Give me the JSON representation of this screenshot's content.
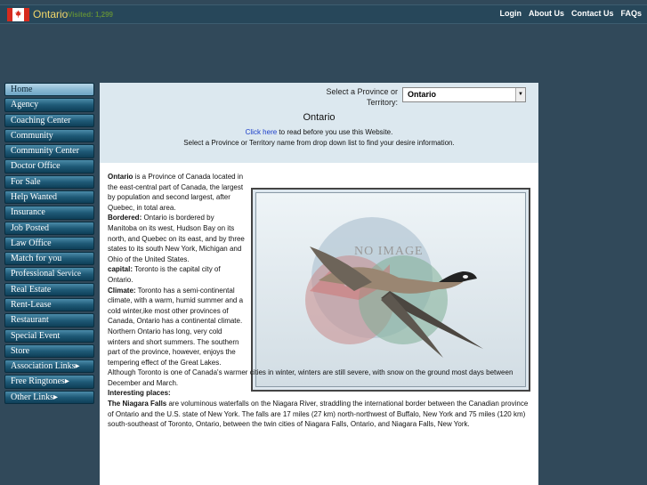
{
  "header": {
    "site_name": "Ontario",
    "visited": "Visited: 1,299",
    "nav": [
      "Login",
      "About Us",
      "Contact Us",
      "FAQs"
    ]
  },
  "sidebar": {
    "items": [
      {
        "label": "Home",
        "active": true
      },
      {
        "label": "Agency"
      },
      {
        "label": "Coaching Center"
      },
      {
        "label": "Community"
      },
      {
        "label": "Community Center"
      },
      {
        "label": "Doctor Office"
      },
      {
        "label": "For Sale"
      },
      {
        "label": "Help Wanted"
      },
      {
        "label": "Insurance"
      },
      {
        "label": "Job Posted"
      },
      {
        "label": "Law Office"
      },
      {
        "label": "Match for you"
      },
      {
        "label": "Professional",
        "small": "Service"
      },
      {
        "label": "Real Estate"
      },
      {
        "label": "Rent-Lease"
      },
      {
        "label": "Restaurant"
      },
      {
        "label": "Special Event"
      },
      {
        "label": "Store"
      },
      {
        "label": "Association Links▸"
      },
      {
        "label": "Free Ringtones▸"
      },
      {
        "label": "Other Links▸"
      }
    ]
  },
  "selector": {
    "label": "Select a Province or Territory:",
    "value": "Ontario",
    "arrow": "▼"
  },
  "main": {
    "title": "Ontario",
    "click_here": "Click here",
    "notice1_rest": " to read before you use this Website.",
    "notice2": "Select a Province or Territory name from drop down list to find your desire information.",
    "image_placeholder": "NO IMAGE"
  },
  "article": {
    "intro_bold": "Ontario",
    "intro": " is a Province of Canada located in the east-central part of Canada, the largest by population and second largest, after Quebec, in total area.",
    "bordered_label": "Bordered:",
    "bordered": " Ontario is bordered by Manitoba on its west, Hudson Bay on its north, and Quebec on its east, and by three states to its south New York, Michigan and Ohio of the United States.",
    "capital_label": "capital:",
    "capital": " Toronto is the capital city of Ontario.",
    "climate_label": "Climate:",
    "climate": " Toronto has a semi-continental climate, with a warm, humid summer and a cold winter,ike most other provinces of Canada, Ontario has a continental climate. Northern Ontario has long, very cold winters and short summers. The southern part of the province, however, enjoys the tempering effect of the Great Lakes.",
    "climate_wide": "Although Toronto is one of Canada's warmer cities in winter, winters are still severe, with snow on the ground most days between December and March.",
    "places_label": "Interesting places:",
    "niagara_label": "The Niagara Falls",
    "niagara": " are voluminous waterfalls on the Niagara River, straddling the international border between the Canadian province of Ontario and the U.S. state of New York. The falls are 17 miles (27 km) north-northwest of Buffalo, New York and 75 miles (120 km) south-southeast of Toronto, Ontario, between the twin cities of Niagara Falls, Ontario, and Niagara Falls, New York."
  },
  "colors": {
    "background": "#31495a",
    "menu_button": "#1f5a77",
    "link": "#1a3dc9"
  }
}
